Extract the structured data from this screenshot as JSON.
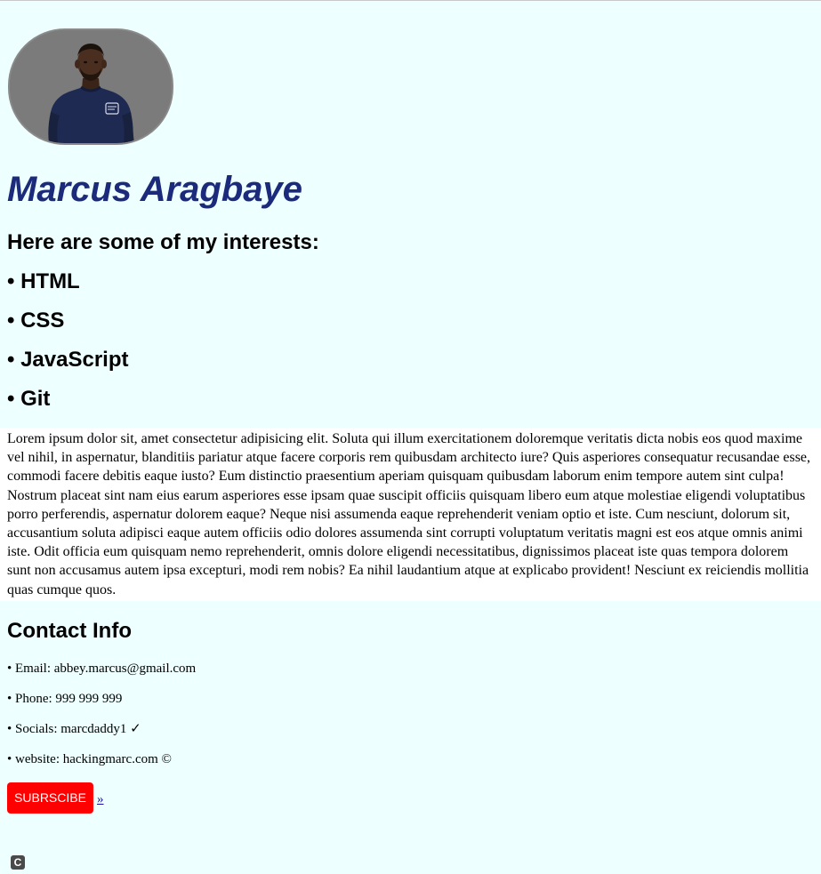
{
  "profile": {
    "name": "Marcus Aragbaye",
    "avatar_alt": "avatar"
  },
  "interests": {
    "title": "Here are some of my interests:",
    "items": [
      "• HTML",
      "• CSS",
      "• JavaScript",
      "• Git"
    ]
  },
  "bio": {
    "text": "Lorem ipsum dolor sit, amet consectetur adipisicing elit. Soluta qui illum exercitationem doloremque veritatis dicta nobis eos quod maxime vel nihil, in aspernatur, blanditiis pariatur atque facere corporis rem quibusdam architecto iure? Quis asperiores consequatur recusandae esse, commodi facere debitis eaque iusto? Eum distinctio praesentium aperiam quisquam quibusdam laborum enim tempore autem sint culpa! Nostrum placeat sint nam eius earum asperiores esse ipsam quae suscipit officiis quisquam libero eum atque molestiae eligendi voluptatibus porro perferendis, aspernatur dolorem eaque? Neque nisi assumenda eaque reprehenderit veniam optio et iste. Cum nesciunt, dolorum sit, accusantium soluta adipisci eaque autem officiis odio dolores assumenda sint corrupti voluptatum veritatis magni est eos atque omnis animi iste. Odit officia eum quisquam nemo reprehenderit, omnis dolore eligendi necessitatibus, dignissimos placeat iste quas tempora dolorem sunt non accusamus autem ipsa excepturi, modi rem nobis? Ea nihil laudantium atque at explicabo provident! Nesciunt ex reiciendis mollitia quas cumque quos."
  },
  "contact": {
    "title": "Contact Info",
    "email": "• Email: abbey.marcus@gmail.com",
    "phone": "• Phone: 999 999 999",
    "socials": "• Socials: marcdaddy1 ✓",
    "website": "• website: hackingmarc.com ©"
  },
  "actions": {
    "subscribe_label": "SUBRSCIBE",
    "more_label": "»"
  },
  "corner_icon": {
    "glyph": "C",
    "icon": "c-badge-icon"
  },
  "colors": {
    "background": "#eeffff",
    "name": "#1c2a7c",
    "subscribe": "#ff0000",
    "link": "#1a0dab"
  }
}
